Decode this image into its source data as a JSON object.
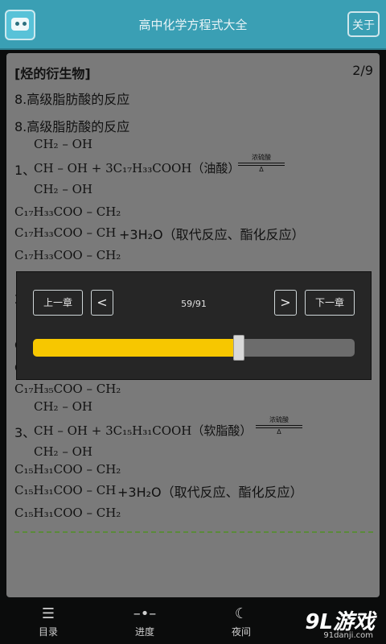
{
  "header": {
    "title": "高中化学方程式大全",
    "about_label": "关于"
  },
  "content": {
    "category": "[烃的衍生物]",
    "page": "2/9",
    "heading1": "8.高级脂肪酸的反应",
    "heading2": "8.高级脂肪酸的反应",
    "eq1": {
      "row1": "CH₂ – OH",
      "row2_prefix": "1、",
      "row2": "CH – OH + 3C₁₇H₃₃COOH（油酸）",
      "row3": "CH₂ – OH",
      "arrow_label": "浓硫酸",
      "arrow_cond": "Δ",
      "p1": "C₁₇H₃₃COO – CH₂",
      "p2": "C₁₇H₃₃COO – CH",
      "p2_suffix": "+3H₂O（取代反应、酯化反应）",
      "p3": "C₁₇H₃₃COO – CH₂"
    },
    "partial1": "2",
    "partial2": "C",
    "partial3": "C",
    "eq2_partial": "C₁₇H₃₅COO – CH₂",
    "eq3": {
      "row1": "CH₂ – OH",
      "row2_prefix": "3、",
      "row2": "CH – OH + 3C₁₅H₃₁COOH（软脂酸）",
      "row3": "CH₂ – OH",
      "arrow_label": "浓硫酸",
      "arrow_cond": "Δ",
      "p1": "C₁₅H₃₁COO – CH₂",
      "p2": "C₁₅H₃₁COO – CH",
      "p2_suffix": "+3H₂O（取代反应、酯化反应）",
      "p3": "C₁₅H₃₁COO – CH₂"
    }
  },
  "navigator": {
    "prev_chapter": "上一章",
    "prev_symbol": "<",
    "counter": "59/91",
    "next_symbol": ">",
    "next_chapter": "下一章",
    "progress": 0.64,
    "colors": {
      "fill": "#f7c700",
      "track": "#6c6c6c"
    }
  },
  "bottom_nav": {
    "items": [
      {
        "label": "目录",
        "icon": "list-icon"
      },
      {
        "label": "进度",
        "icon": "progress-icon"
      },
      {
        "label": "夜间",
        "icon": "moon-icon"
      }
    ]
  },
  "watermark": {
    "brand": "9L游戏",
    "url": "91danji.com"
  }
}
